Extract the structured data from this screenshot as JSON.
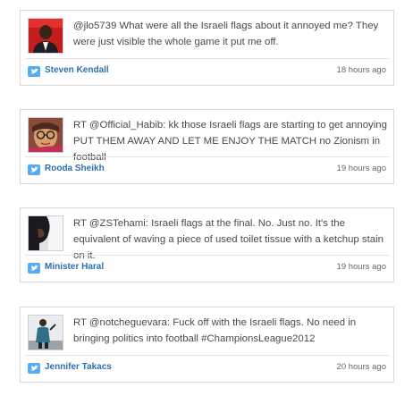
{
  "colors": {
    "accent": "#2e6fb0",
    "border": "#d9d9d9",
    "twitter": "#55acee"
  },
  "tweets": [
    {
      "avatar_icon": "user-avatar-red-background",
      "text": "@jlo5739 What were all the Israeli flags about it annoyed me? They were just visible the whole game it put me off.",
      "name": "Steven Kendall",
      "time": "18 hours ago"
    },
    {
      "avatar_icon": "user-avatar-glasses",
      "text": "RT @Official_Habib: kk those Israeli flags are starting to get annoying PUT THEM AWAY AND LET ME ENJOY THE MATCH no Zionism in football",
      "name": "Rooda Sheikh",
      "time": "19 hours ago"
    },
    {
      "avatar_icon": "user-avatar-dark-profile",
      "text": "RT @ZSTehami: Israeli flags at the final. No. Just no. It's the equivalent of waving a piece of used toilet tissue with a ketchup stain on it.",
      "name": "Minister Haral",
      "time": "19 hours ago"
    },
    {
      "avatar_icon": "user-avatar-standing-figure",
      "text": "RT @notcheguevara: Fuck off with the Israeli flags. No need in bringing politics into football #ChampionsLeague2012",
      "name": "Jennifer Takacs",
      "time": "20 hours ago"
    }
  ]
}
